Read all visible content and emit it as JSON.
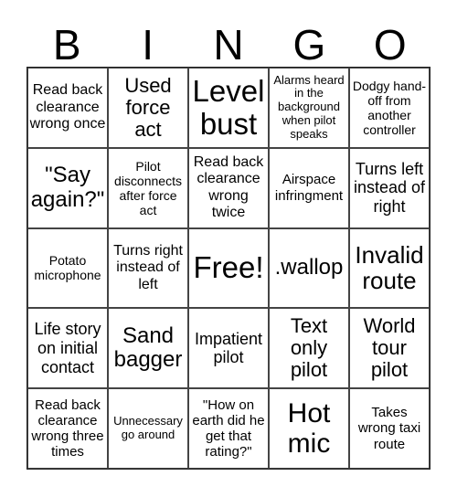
{
  "header": {
    "letters": [
      "B",
      "I",
      "N",
      "G",
      "O"
    ]
  },
  "board": {
    "rows": [
      [
        {
          "text": "Read back clearance wrong once"
        },
        {
          "text": "Used force act"
        },
        {
          "text": "Level bust"
        },
        {
          "text": "Alarms heard in the background when pilot speaks"
        },
        {
          "text": "Dodgy hand-off from another controller"
        }
      ],
      [
        {
          "text": "\"Say again?\""
        },
        {
          "text": "Pilot disconnects after force act"
        },
        {
          "text": "Read back clearance wrong twice"
        },
        {
          "text": "Airspace infringment"
        },
        {
          "text": "Turns left instead of right"
        }
      ],
      [
        {
          "text": "Potato microphone"
        },
        {
          "text": "Turns right instead of left"
        },
        {
          "text": "Free!"
        },
        {
          "text": ".wallop"
        },
        {
          "text": "Invalid route"
        }
      ],
      [
        {
          "text": "Life story on initial contact"
        },
        {
          "text": "Sand bagger"
        },
        {
          "text": "Impatient pilot"
        },
        {
          "text": "Text only pilot"
        },
        {
          "text": "World tour pilot"
        }
      ],
      [
        {
          "text": "Read back clearance wrong three times"
        },
        {
          "text": "Unnecessary go around"
        },
        {
          "text": "\"How on earth did he get that rating?\""
        },
        {
          "text": "Hot mic"
        },
        {
          "text": "Takes wrong taxi route"
        }
      ]
    ]
  }
}
